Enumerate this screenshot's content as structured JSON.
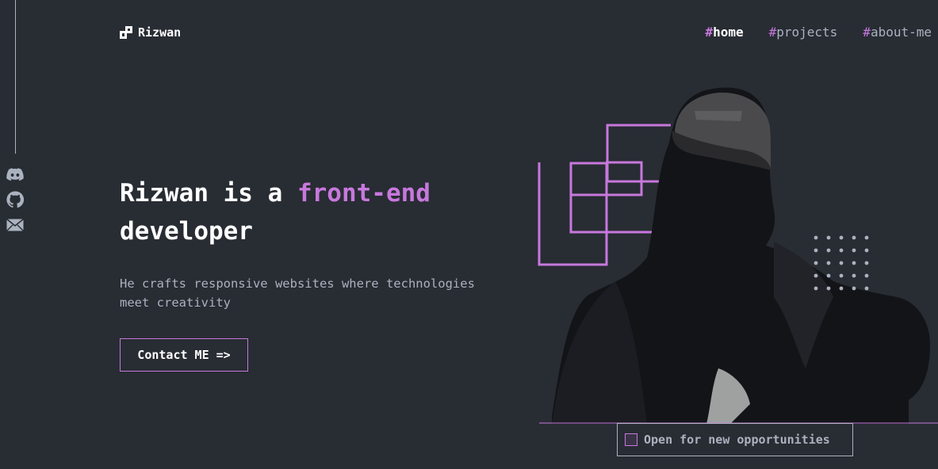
{
  "brand": {
    "name": "Rizwan"
  },
  "nav": [
    {
      "prefix": "#",
      "label": "home",
      "active": true
    },
    {
      "prefix": "#",
      "label": "projects",
      "active": false
    },
    {
      "prefix": "#",
      "label": "about-me",
      "active": false
    }
  ],
  "socials": [
    {
      "icon": "discord-icon"
    },
    {
      "icon": "github-icon"
    },
    {
      "icon": "email-icon"
    }
  ],
  "hero": {
    "headline_start": "Rizwan is a ",
    "headline_accent": "front-end",
    "headline_end": "developer",
    "subline": "He crafts responsive websites where technologies meet creativity",
    "cta": "Contact ME =>"
  },
  "status": {
    "text": "Open for new opportunities"
  },
  "colors": {
    "background": "#282c33",
    "accent": "#c778dd",
    "muted": "#abb2bf",
    "text": "#ffffff"
  }
}
